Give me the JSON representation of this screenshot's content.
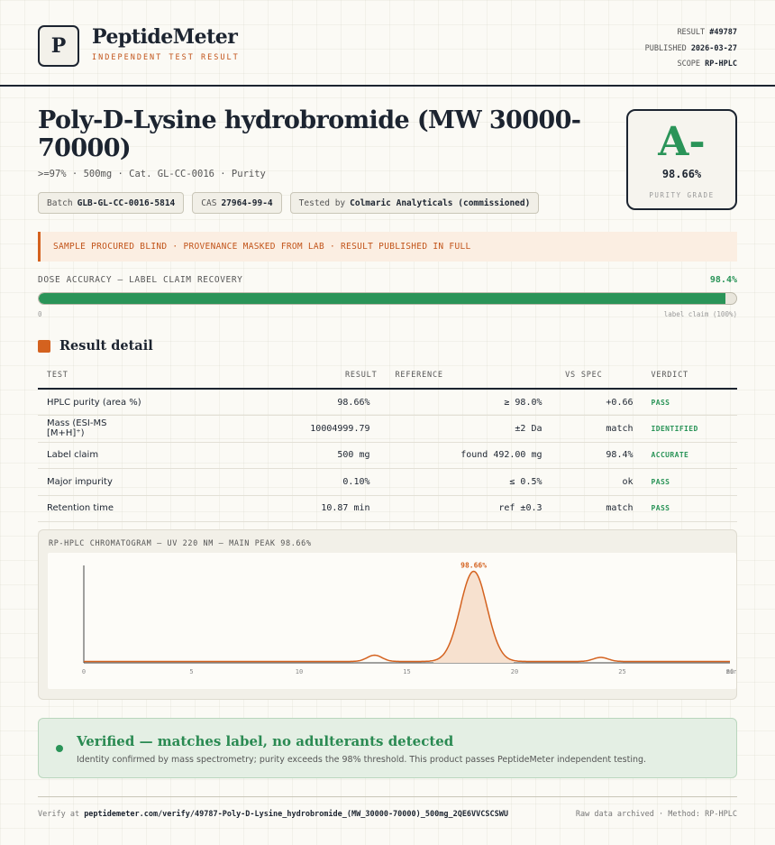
{
  "header": {
    "logo_letter": "P",
    "brand": "PeptideMeter",
    "brand_sub": "INDEPENDENT TEST RESULT",
    "result_label": "RESULT",
    "result_value": "#49787",
    "published_label": "PUBLISHED",
    "published_value": "2026-03-27",
    "scope_label": "SCOPE",
    "scope_value": "RP-HPLC"
  },
  "product": {
    "title": "Poly-D-Lysine hydrobromide (MW 30000-70000)",
    "subtitle": ">=97% · 500mg · Cat. GL-CC-0016 · Purity",
    "chips": [
      {
        "label": "Batch",
        "value": "GLB-GL-CC-0016-5814"
      },
      {
        "label": "CAS",
        "value": "27964-99-4"
      },
      {
        "label": "Tested by",
        "value": "Colmaric Analyticals (commissioned)"
      }
    ]
  },
  "grade": {
    "letter": "A-",
    "value": "98.66%",
    "label": "PURITY GRADE"
  },
  "banner": "SAMPLE PROCURED BLIND · PROVENANCE MASKED FROM LAB · RESULT PUBLISHED IN FULL",
  "dose": {
    "label": "DOSE ACCURACY — LABEL CLAIM RECOVERY",
    "value_text": "98.4%",
    "fraction": 0.984,
    "zero_label": "0",
    "end_label": "label claim (100%)"
  },
  "section_title": "Result detail",
  "table": {
    "headers": [
      "TEST",
      "RESULT",
      "REFERENCE",
      "VS SPEC",
      "VERDICT"
    ],
    "rows": [
      {
        "test": "HPLC purity (area %)",
        "result": "98.66%",
        "reference": "≥ 98.0%",
        "vs": "+0.66",
        "verdict": "PASS"
      },
      {
        "test": "Mass (ESI-MS [M+H]⁺)",
        "result": "10004999.79",
        "reference": "±2 Da",
        "vs": "match",
        "verdict": "IDENTIFIED"
      },
      {
        "test": "Label claim",
        "result": "500 mg",
        "reference": "found 492.00 mg",
        "vs": "98.4%",
        "verdict": "ACCURATE"
      },
      {
        "test": "Major impurity",
        "result": "0.10%",
        "reference": "≤ 0.5%",
        "vs": "ok",
        "verdict": "PASS"
      },
      {
        "test": "Retention time",
        "result": "10.87 min",
        "reference": "ref ±0.3",
        "vs": "match",
        "verdict": "PASS"
      }
    ]
  },
  "chart_data": {
    "type": "line",
    "title": "RP-HPLC CHROMATOGRAM — UV 220 NM — MAIN PEAK 98.66%",
    "x_ticks": [
      0,
      5,
      10,
      15,
      20,
      25,
      30
    ],
    "x_tick_labels": [
      "0",
      "5",
      "10",
      "15",
      "20",
      "25",
      "30"
    ],
    "x_unit": "min",
    "xlim": [
      0,
      30
    ],
    "ylim": [
      0,
      100
    ],
    "peak_label": "98.66%",
    "peaks": [
      {
        "rt": 13.5,
        "height": 7,
        "width": 0.35
      },
      {
        "rt": 18.1,
        "height": 100,
        "width": 0.62
      },
      {
        "rt": 24.0,
        "height": 4.5,
        "width": 0.35
      }
    ],
    "baseline": 1.5,
    "line_color": "#d4621f",
    "fill_color": "#f7e1cf"
  },
  "verified": {
    "title": "Verified — matches label, no adulterants detected",
    "subtitle": "Identity confirmed by mass spectrometry; purity exceeds the 98% threshold. This product passes PeptideMeter independent testing."
  },
  "footer": {
    "verify_prefix": "Verify at",
    "verify_url": "peptidemeter.com/verify/49787-Poly-D-Lysine_hydrobromide_(MW_30000-70000)_500mg_2QE6VVCSCSWU",
    "right": "Raw data archived · Method: RP-HPLC"
  },
  "colors": {
    "accent": "#d4621f",
    "pass": "#2a9458",
    "ink": "#1c2430"
  }
}
